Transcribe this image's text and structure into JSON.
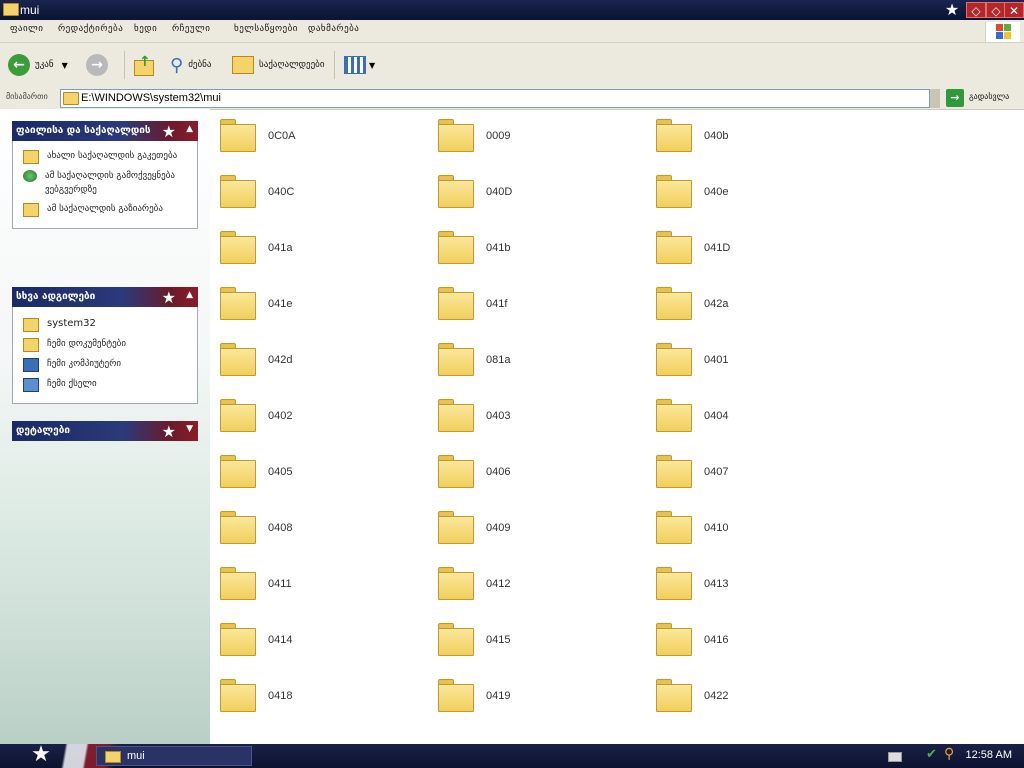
{
  "window": {
    "title": "mui"
  },
  "menu": {
    "items": [
      "ფაილი",
      "რედაქტირება",
      "ხედი",
      "რჩეული",
      "ხელსაწყოები",
      "დახმარება"
    ]
  },
  "toolbar": {
    "back_label": "უკან",
    "search_label": "ძებნა",
    "folders_label": "საქაღალდეები"
  },
  "address": {
    "label": "მისამართი",
    "path": "E:\\WINDOWS\\system32\\mui",
    "go_label": "გადასვლა"
  },
  "tasks_panel": {
    "title": "ფაილისა და საქაღალდის",
    "items": [
      {
        "icon": "new-folder-icon",
        "label": "ახალი საქაღალდის გაკეთება"
      },
      {
        "icon": "globe-icon",
        "label": "ამ საქაღალდის გამოქვეყნება ვებგვერდზე"
      },
      {
        "icon": "share-folder-icon",
        "label": "ამ საქაღალდის გაზიარება"
      }
    ]
  },
  "places_panel": {
    "title": "სხვა ადგილები",
    "items": [
      {
        "icon": "folder-icon",
        "label": "system32"
      },
      {
        "icon": "my-documents-icon",
        "label": "ჩემი დოკუმენტები"
      },
      {
        "icon": "my-computer-icon",
        "label": "ჩემი კომპიუტერი"
      },
      {
        "icon": "network-icon",
        "label": "ჩემი ქსელი"
      }
    ]
  },
  "details_panel": {
    "title": "დეტალები"
  },
  "folders": [
    "0C0A",
    "0009",
    "040b",
    "040C",
    "040D",
    "040e",
    "041a",
    "041b",
    "041D",
    "041e",
    "041f",
    "042a",
    "042d",
    "081a",
    "0401",
    "0402",
    "0403",
    "0404",
    "0405",
    "0406",
    "0407",
    "0408",
    "0409",
    "0410",
    "0411",
    "0412",
    "0413",
    "0414",
    "0415",
    "0416",
    "0418",
    "0419",
    "0422"
  ],
  "taskbar": {
    "task_label": "mui",
    "clock": "12:58 AM"
  }
}
